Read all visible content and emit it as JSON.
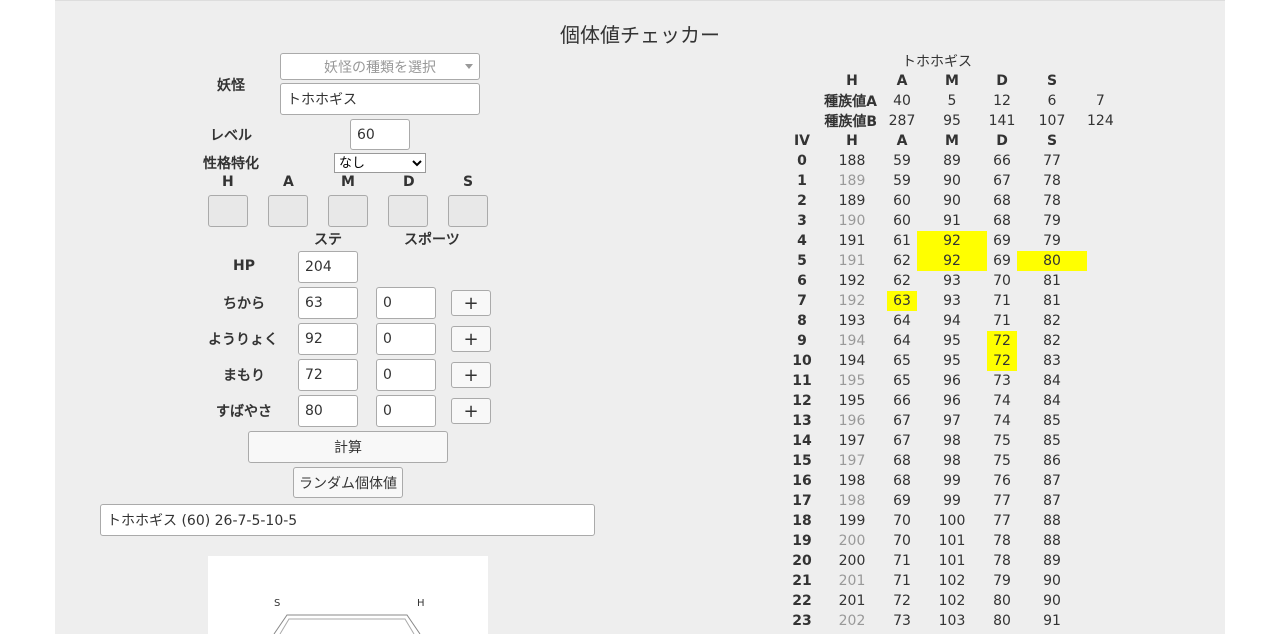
{
  "page": {
    "title": "個体値チェッカー"
  },
  "form": {
    "youkai_label": "妖怪",
    "species_placeholder": "妖怪の種類を選択",
    "name_value": "トホホギス",
    "level_label": "レベル",
    "level_value": "60",
    "nature_label": "性格特化",
    "nature_value": "なし",
    "stat_headers": [
      "H",
      "A",
      "M",
      "D",
      "S"
    ],
    "col_ste": "ステ",
    "col_sports": "スポーツ",
    "hp_label": "HP",
    "hp_value": "204",
    "stats": [
      {
        "label": "ちから",
        "value": "63",
        "sports": "0",
        "plus": "+"
      },
      {
        "label": "ようりょく",
        "value": "92",
        "sports": "0",
        "plus": "+"
      },
      {
        "label": "まもり",
        "value": "72",
        "sports": "0",
        "plus": "+"
      },
      {
        "label": "すばやさ",
        "value": "80",
        "sports": "0",
        "plus": "+"
      }
    ],
    "calc_button": "計算",
    "random_button": "ランダム個体値",
    "result_text": "トホホギス (60) 26-7-5-10-5"
  },
  "radar": {
    "labels": [
      "S",
      "H"
    ]
  },
  "table": {
    "name": "トホホギス",
    "headers": [
      "H",
      "A",
      "M",
      "D",
      "S"
    ],
    "base_a_label": "種族値A",
    "base_a": [
      "40",
      "5",
      "12",
      "6",
      "7"
    ],
    "base_b_label": "種族値B",
    "base_b": [
      "287",
      "95",
      "141",
      "107",
      "124"
    ],
    "iv_headers": [
      "IV",
      "H",
      "A",
      "M",
      "D",
      "S"
    ],
    "rows": [
      [
        "0",
        "188",
        "59",
        "89",
        "66",
        "77"
      ],
      [
        "1",
        "189",
        "59",
        "90",
        "67",
        "78"
      ],
      [
        "2",
        "189",
        "60",
        "90",
        "68",
        "78"
      ],
      [
        "3",
        "190",
        "60",
        "91",
        "68",
        "79"
      ],
      [
        "4",
        "191",
        "61",
        "92",
        "69",
        "79"
      ],
      [
        "5",
        "191",
        "62",
        "92",
        "69",
        "80"
      ],
      [
        "6",
        "192",
        "62",
        "93",
        "70",
        "81"
      ],
      [
        "7",
        "192",
        "63",
        "93",
        "71",
        "81"
      ],
      [
        "8",
        "193",
        "64",
        "94",
        "71",
        "82"
      ],
      [
        "9",
        "194",
        "64",
        "95",
        "72",
        "82"
      ],
      [
        "10",
        "194",
        "65",
        "95",
        "72",
        "83"
      ],
      [
        "11",
        "195",
        "65",
        "96",
        "73",
        "84"
      ],
      [
        "12",
        "195",
        "66",
        "96",
        "74",
        "84"
      ],
      [
        "13",
        "196",
        "67",
        "97",
        "74",
        "85"
      ],
      [
        "14",
        "197",
        "67",
        "98",
        "75",
        "85"
      ],
      [
        "15",
        "197",
        "68",
        "98",
        "75",
        "86"
      ],
      [
        "16",
        "198",
        "68",
        "99",
        "76",
        "87"
      ],
      [
        "17",
        "198",
        "69",
        "99",
        "77",
        "87"
      ],
      [
        "18",
        "199",
        "70",
        "100",
        "77",
        "88"
      ],
      [
        "19",
        "200",
        "70",
        "101",
        "78",
        "88"
      ],
      [
        "20",
        "200",
        "71",
        "101",
        "78",
        "89"
      ],
      [
        "21",
        "201",
        "71",
        "102",
        "79",
        "90"
      ],
      [
        "22",
        "201",
        "72",
        "102",
        "80",
        "90"
      ],
      [
        "23",
        "202",
        "73",
        "103",
        "80",
        "91"
      ]
    ],
    "gray_rows_h": [
      1,
      3,
      5,
      7,
      9,
      11,
      13,
      15,
      17,
      19,
      21,
      23
    ],
    "highlight": [
      [
        4,
        3
      ],
      [
        5,
        3
      ],
      [
        5,
        5
      ],
      [
        7,
        2
      ],
      [
        9,
        4
      ],
      [
        10,
        4
      ]
    ],
    "highlight_color": "#ffff00"
  }
}
